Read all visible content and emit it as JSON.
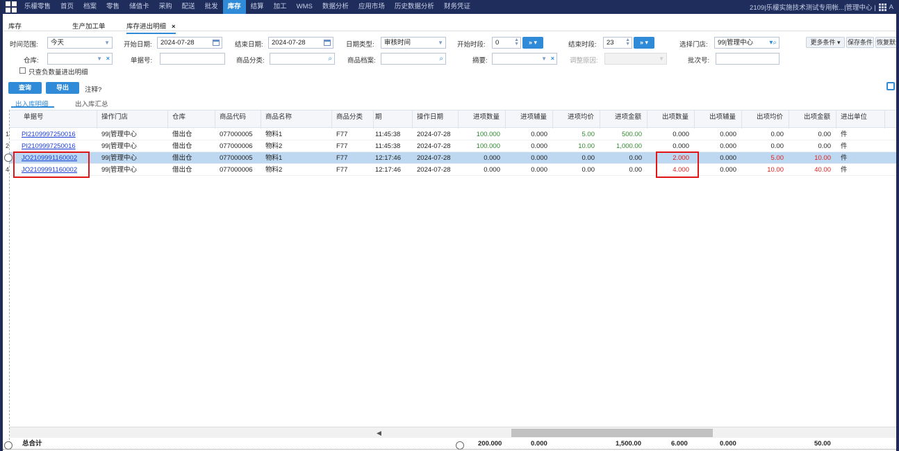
{
  "topnav": {
    "items": [
      "乐檬零售",
      "首页",
      "档案",
      "零售",
      "储值卡",
      "采购",
      "配送",
      "批发",
      "库存",
      "结算",
      "加工",
      "WMS",
      "数据分析",
      "应用市场",
      "历史数据分析",
      "财务凭证"
    ],
    "active": "库存",
    "right_text": "2109|乐檬实施技术测试专用帐...|管理中心 |",
    "right_extra": "A"
  },
  "tabs": {
    "t0": "库存",
    "t1": "生产加工单",
    "t2": "库存进出明细",
    "close": "×"
  },
  "filters": {
    "time_range_label": "时间范围:",
    "time_range_value": "今天",
    "start_date_label": "开始日期:",
    "start_date_value": "2024-07-28",
    "end_date_label": "结束日期:",
    "end_date_value": "2024-07-28",
    "date_type_label": "日期类型:",
    "date_type_value": "审核时间",
    "start_period_label": "开始时段:",
    "start_period_value": "0",
    "end_period_label": "结束时段:",
    "end_period_value": "23",
    "store_label": "选择门店:",
    "store_value": "99|管理中心",
    "more_conditions": "更多条件 ▾",
    "save_conditions": "保存条件",
    "restore_default": "恢复默认",
    "warehouse_label": "仓库:",
    "doc_no_label": "单据号:",
    "category_label": "商品分类:",
    "item_file_label": "商品档案:",
    "summary_label": "摘要:",
    "adjust_reason_label": "调整原因:",
    "batch_label": "批次号:",
    "negative_only_label": "只查负数量进出明细",
    "query_btn": "查询",
    "export_btn": "导出",
    "note": "注释?",
    "arrows": "» ▾"
  },
  "subtabs": [
    "出入库明细",
    "出入库汇总"
  ],
  "table": {
    "columns": [
      "单据号",
      "操作门店",
      "仓库",
      "商品代码",
      "商品名称",
      "商品分类",
      "期",
      "操作日期",
      "进项数量",
      "进项辅量",
      "进项均价",
      "进项金额",
      "出项数量",
      "出项辅量",
      "出项均价",
      "出项金额",
      "进出单位"
    ],
    "rows": [
      {
        "n": "1",
        "doc": "PI2109997250016",
        "store": "99|管理中心",
        "wh": "借出仓",
        "code": "077000005",
        "name": "物料1",
        "cat": "F77",
        "time": "11:45:38",
        "date": "2024-07-28",
        "in_qty": "100.000",
        "in_aux": "0.000",
        "in_price": "5.00",
        "in_amt": "500.00",
        "out_qty": "0.000",
        "out_aux": "0.000",
        "out_price": "0.00",
        "out_amt": "0.00",
        "unit": "件"
      },
      {
        "n": "2",
        "doc": "PI2109997250016",
        "store": "99|管理中心",
        "wh": "借出仓",
        "code": "077000006",
        "name": "物料2",
        "cat": "F77",
        "time": "11:45:38",
        "date": "2024-07-28",
        "in_qty": "100.000",
        "in_aux": "0.000",
        "in_price": "10.00",
        "in_amt": "1,000.00",
        "out_qty": "0.000",
        "out_aux": "0.000",
        "out_price": "0.00",
        "out_amt": "0.00",
        "unit": "件"
      },
      {
        "n": "",
        "doc": "JO2109991160002",
        "store": "99|管理中心",
        "wh": "借出仓",
        "code": "077000005",
        "name": "物料1",
        "cat": "F77",
        "time": "12:17:46",
        "date": "2024-07-28",
        "in_qty": "0.000",
        "in_aux": "0.000",
        "in_price": "0.00",
        "in_amt": "0.00",
        "out_qty": "2.000",
        "out_aux": "0.000",
        "out_price": "5.00",
        "out_amt": "10.00",
        "unit": "件"
      },
      {
        "n": "4",
        "doc": "JO2109991160002",
        "store": "99|管理中心",
        "wh": "借出仓",
        "code": "077000006",
        "name": "物料2",
        "cat": "F77",
        "time": "12:17:46",
        "date": "2024-07-28",
        "in_qty": "0.000",
        "in_aux": "0.000",
        "in_price": "0.00",
        "in_amt": "0.00",
        "out_qty": "4.000",
        "out_aux": "0.000",
        "out_price": "10.00",
        "out_amt": "40.00",
        "unit": "件"
      }
    ]
  },
  "totals": {
    "label": "总合计",
    "in_qty": "200.000",
    "in_aux": "0.000",
    "in_amt": "1,500.00",
    "out_qty": "6.000",
    "out_aux": "0.000",
    "out_amt": "50.00"
  },
  "scroll_left": "◀"
}
